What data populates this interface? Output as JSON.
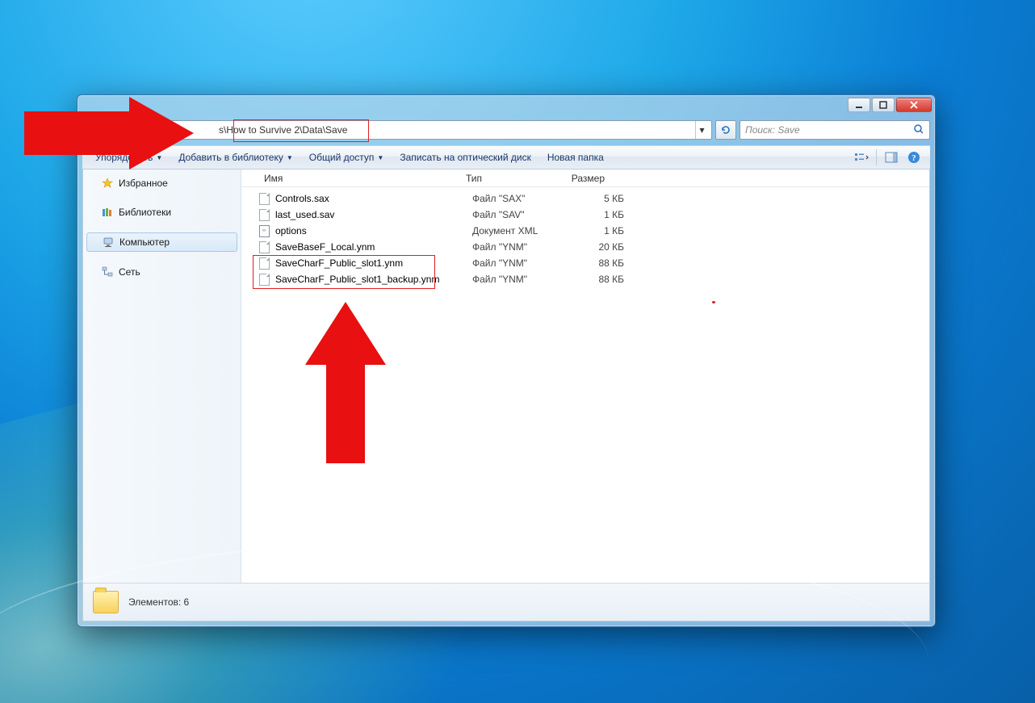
{
  "window": {
    "address_path": "s\\How to Survive 2\\Data\\Save",
    "search_placeholder": "Поиск: Save"
  },
  "toolbar": {
    "organize": "Упорядочить",
    "add_to_library": "Добавить в библиотеку",
    "share": "Общий доступ",
    "burn": "Записать на оптический диск",
    "new_folder": "Новая папка"
  },
  "nav_pane": {
    "favorites": "Избранное",
    "libraries": "Библиотеки",
    "computer": "Компьютер",
    "network": "Сеть"
  },
  "columns": {
    "name": "Имя",
    "type": "Тип",
    "size": "Размер"
  },
  "files": [
    {
      "name": "Controls.sax",
      "type": "Файл \"SAX\"",
      "size": "5 КБ",
      "icon": "page"
    },
    {
      "name": "last_used.sav",
      "type": "Файл \"SAV\"",
      "size": "1 КБ",
      "icon": "page"
    },
    {
      "name": "options",
      "type": "Документ XML",
      "size": "1 КБ",
      "icon": "xml"
    },
    {
      "name": "SaveBaseF_Local.ynm",
      "type": "Файл \"YNM\"",
      "size": "20 КБ",
      "icon": "page"
    },
    {
      "name": "SaveCharF_Public_slot1.ynm",
      "type": "Файл \"YNM\"",
      "size": "88 КБ",
      "icon": "page"
    },
    {
      "name": "SaveCharF_Public_slot1_backup.ynm",
      "type": "Файл \"YNM\"",
      "size": "88 КБ",
      "icon": "page"
    }
  ],
  "details": {
    "summary": "Элементов: 6"
  }
}
